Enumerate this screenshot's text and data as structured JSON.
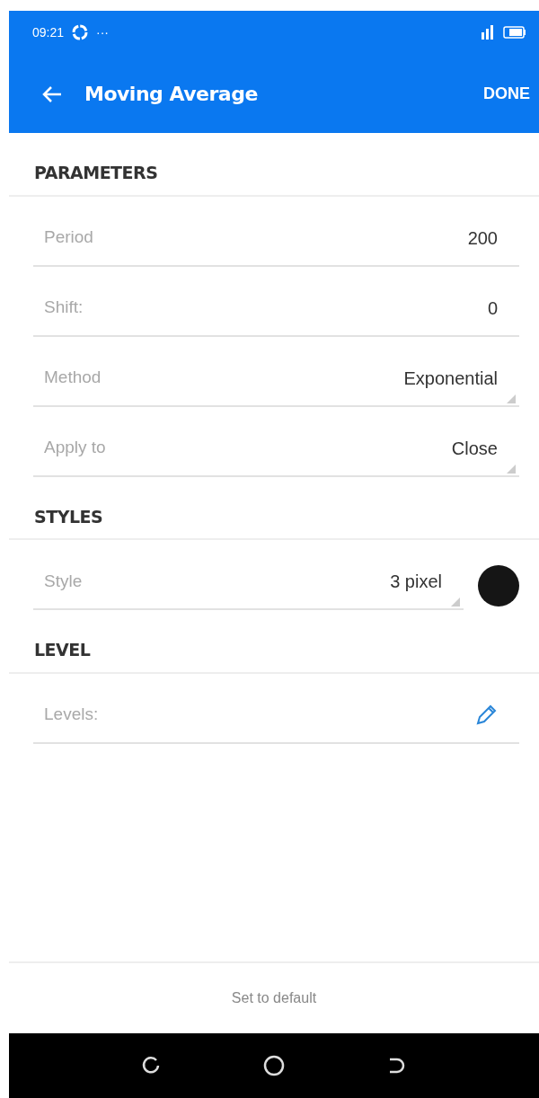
{
  "status_bar": {
    "time": "09:21",
    "overflow": "···"
  },
  "toolbar": {
    "title": "Moving Average",
    "action": "DONE"
  },
  "sections": [
    {
      "title": "PARAMETERS",
      "rows": [
        {
          "kind": "number",
          "label": "Period",
          "value": "200"
        },
        {
          "kind": "number",
          "label": "Shift:",
          "value": "0"
        },
        {
          "kind": "dropdown",
          "label": "Method",
          "value": "Exponential"
        },
        {
          "kind": "dropdown",
          "label": "Apply to",
          "value": "Close"
        }
      ]
    },
    {
      "title": "STYLES",
      "rows": [
        {
          "kind": "style",
          "label": "Style",
          "value": "3 pixel",
          "color": "#151515"
        }
      ]
    },
    {
      "title": "LEVEL",
      "rows": [
        {
          "kind": "edit",
          "label": "Levels:"
        }
      ]
    }
  ],
  "footer": {
    "button": "Set to default"
  }
}
